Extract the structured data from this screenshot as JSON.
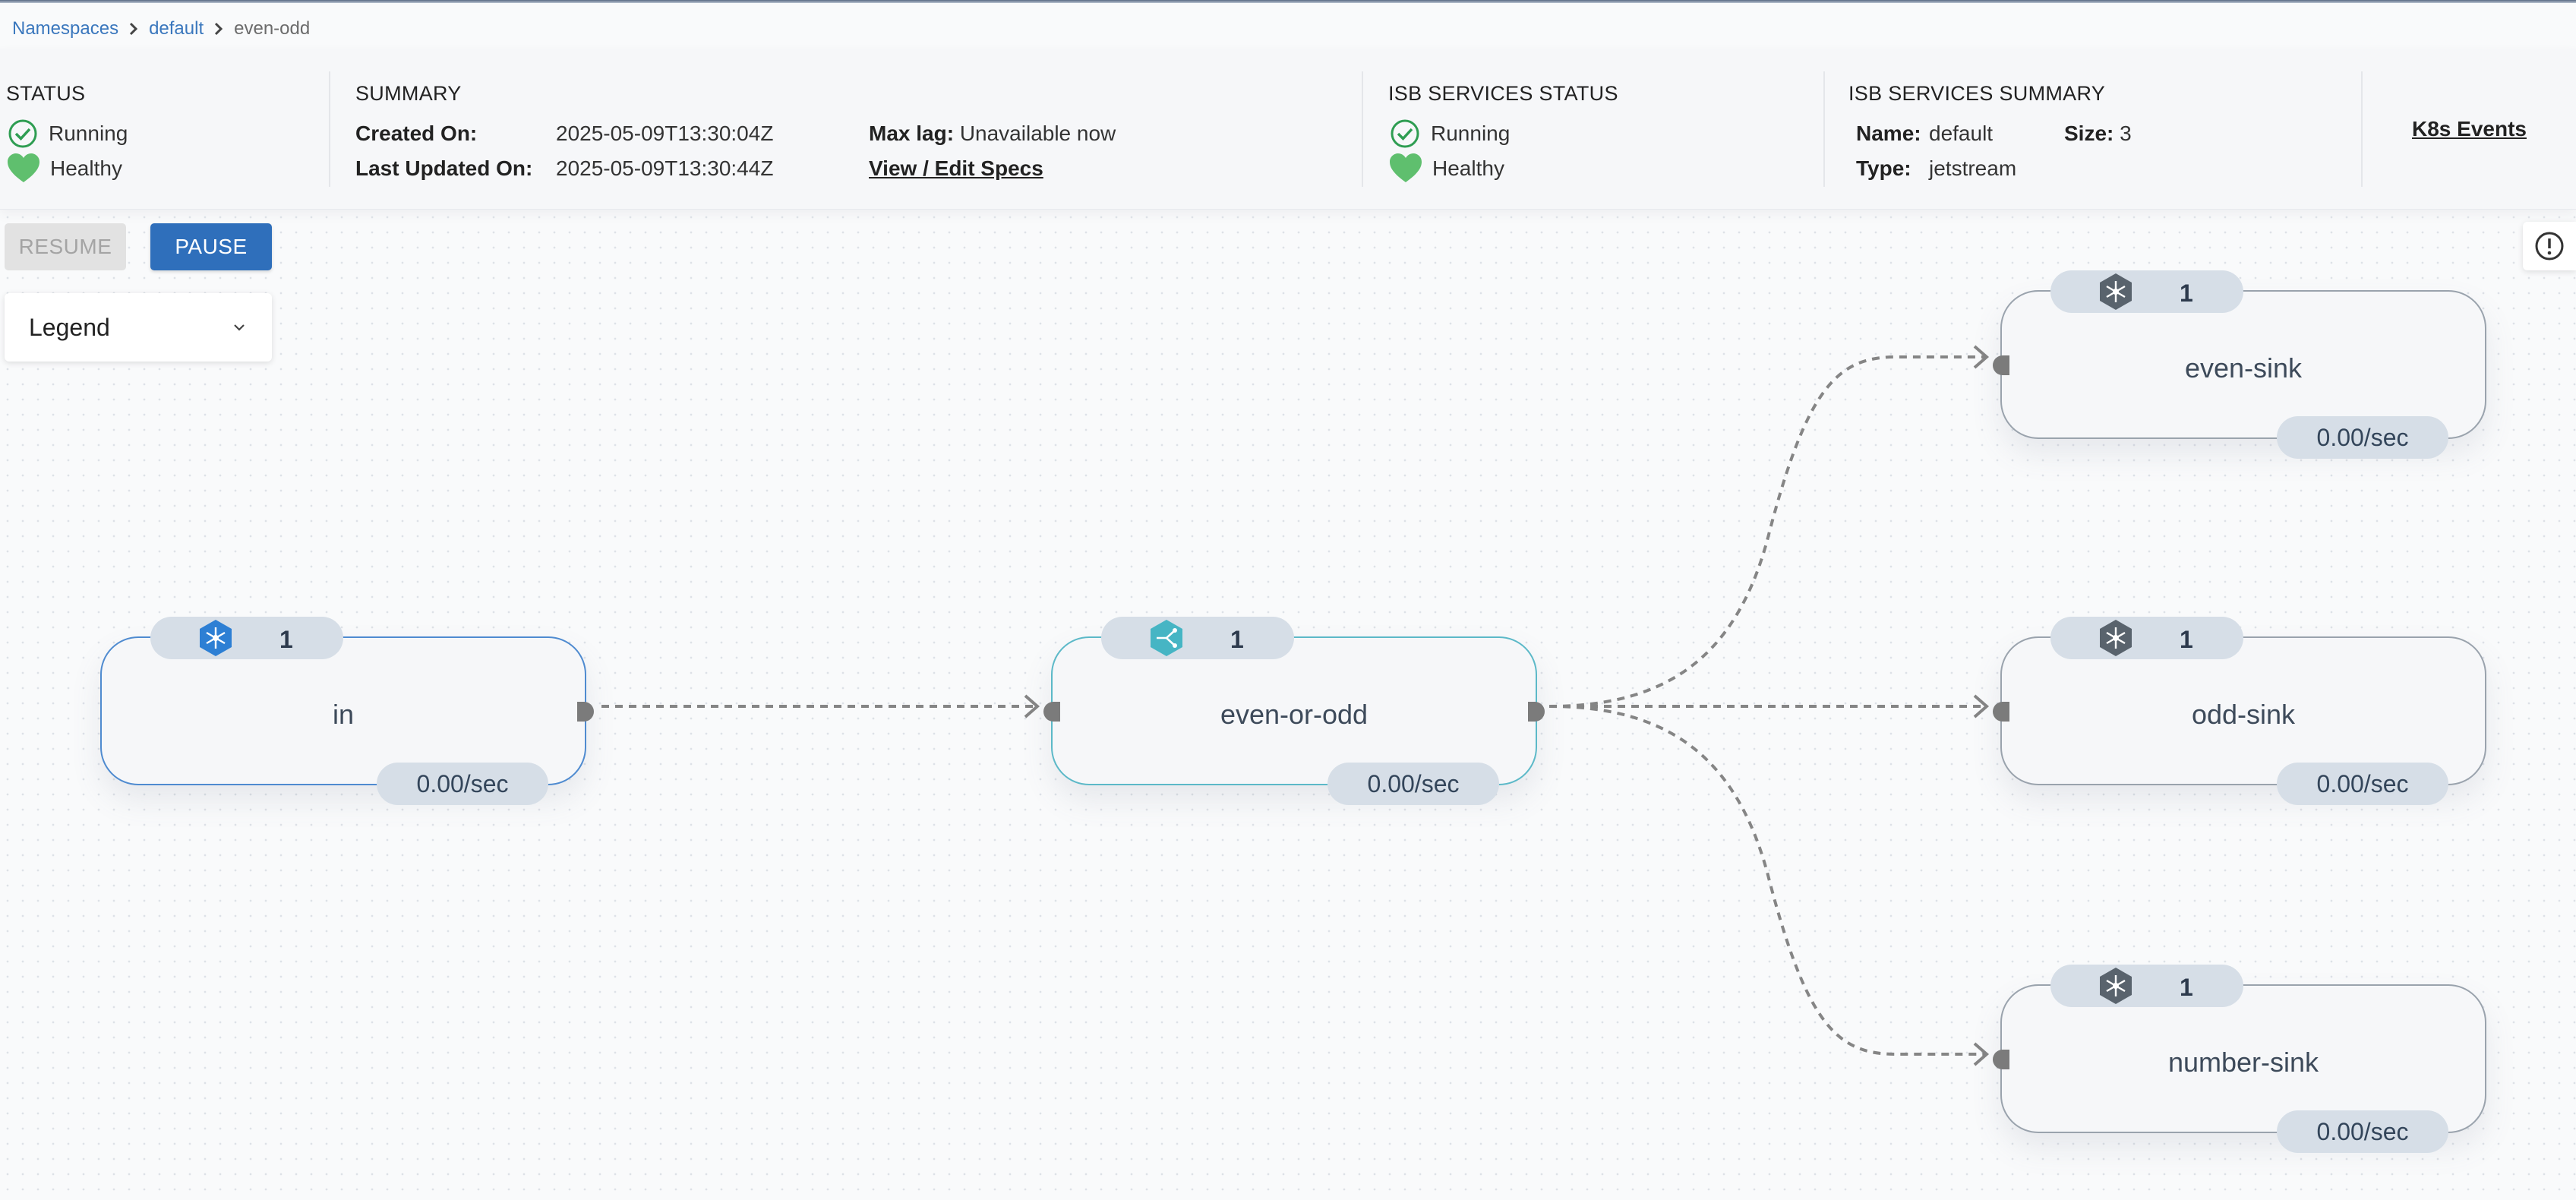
{
  "breadcrumb": {
    "items": [
      "Namespaces",
      "default"
    ],
    "current": "even-odd"
  },
  "status": {
    "title": "STATUS",
    "running": "Running",
    "healthy": "Healthy"
  },
  "summary": {
    "title": "SUMMARY",
    "created_label": "Created On:",
    "created_value": "2025-05-09T13:30:04Z",
    "updated_label": "Last Updated On:",
    "updated_value": "2025-05-09T13:30:44Z",
    "maxlag_label": "Max lag:",
    "maxlag_value": "Unavailable now",
    "view_specs": "View / Edit Specs"
  },
  "isb_status": {
    "title": "ISB SERVICES STATUS",
    "running": "Running",
    "healthy": "Healthy"
  },
  "isb_summary": {
    "title": "ISB SERVICES SUMMARY",
    "name_label": "Name:",
    "name_value": "default",
    "size_label": "Size:",
    "size_value": "3",
    "type_label": "Type:",
    "type_value": "jetstream"
  },
  "k8s_events": "K8s Events",
  "controls": {
    "resume": "RESUME",
    "pause": "PAUSE",
    "legend": "Legend"
  },
  "colors": {
    "accent": "#2f6fbb",
    "link": "#3a77bd",
    "ok_green": "#2e9d52",
    "heart_green": "#5fbf6e",
    "source_blue": "#2d7fd4",
    "udf_teal": "#46b5c4",
    "sink_gray": "#59636d"
  },
  "nodes": [
    {
      "name": "in",
      "type": "source",
      "icon": "source-icon",
      "pods": "1",
      "rate": "0.00/sec"
    },
    {
      "name": "even-or-odd",
      "type": "udf",
      "icon": "udf-icon",
      "pods": "1",
      "rate": "0.00/sec"
    },
    {
      "name": "even-sink",
      "type": "sink",
      "icon": "sink-icon",
      "pods": "1",
      "rate": "0.00/sec"
    },
    {
      "name": "odd-sink",
      "type": "sink",
      "icon": "sink-icon",
      "pods": "1",
      "rate": "0.00/sec"
    },
    {
      "name": "number-sink",
      "type": "sink",
      "icon": "sink-icon",
      "pods": "1",
      "rate": "0.00/sec"
    }
  ],
  "edges": [
    {
      "from": "in",
      "to": "even-or-odd"
    },
    {
      "from": "even-or-odd",
      "to": "even-sink"
    },
    {
      "from": "even-or-odd",
      "to": "odd-sink"
    },
    {
      "from": "even-or-odd",
      "to": "number-sink"
    }
  ]
}
